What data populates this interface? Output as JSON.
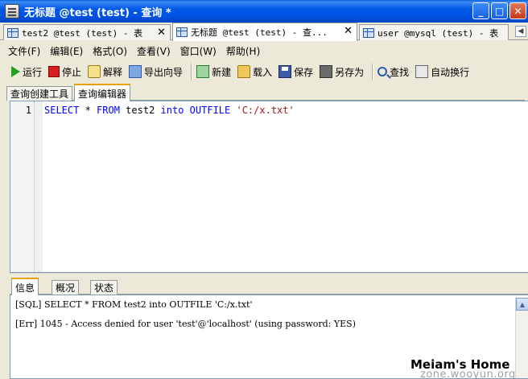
{
  "window": {
    "title": "无标题 @test (test) - 查询 *",
    "minimize_label": "_",
    "maximize_label": "□",
    "close_label": "✕"
  },
  "doc_tabs": [
    {
      "label": "test2 @test (test) - 表",
      "close": "✕"
    },
    {
      "label": "无标题 @test (test) - 查...",
      "close": "✕"
    },
    {
      "label": "user @mysql (test) - 表",
      "close": ""
    }
  ],
  "doc_tab_nav": {
    "prev": "◀",
    "next": "▶"
  },
  "menu": [
    "文件(F)",
    "编辑(E)",
    "格式(O)",
    "查看(V)",
    "窗口(W)",
    "帮助(H)"
  ],
  "toolbar": {
    "run": "运行",
    "stop": "停止",
    "explain": "解释",
    "export_wizard": "导出向导",
    "new": "新建",
    "load": "载入",
    "save": "保存",
    "save_as": "另存为",
    "find": "查找",
    "word_wrap": "自动换行"
  },
  "sub_tabs": [
    "查询创建工具",
    "查询编辑器"
  ],
  "editor": {
    "line_number": "1",
    "tokens": [
      "SELECT",
      " * ",
      "FROM",
      " test2 ",
      "into",
      " ",
      "OUTFILE",
      " 'C:/x.txt'"
    ]
  },
  "bottom_tabs": [
    "信息",
    "概况",
    "状态"
  ],
  "messages": {
    "sql_line": "[SQL] SELECT * FROM test2 into OUTFILE 'C:/x.txt'",
    "err_line": "[Err] 1045 - Access denied for user 'test'@'localhost' (using password: YES)"
  },
  "scrollbar": {
    "up": "▲"
  },
  "watermark": {
    "line1": "Meiam's Home",
    "line2": "zone.wooyun.org"
  },
  "icons": [
    "app-icon",
    "run-icon",
    "stop-icon",
    "explain-icon",
    "export-icon",
    "new-icon",
    "load-icon",
    "save-icon",
    "save-as-icon",
    "find-icon",
    "word-wrap-icon",
    "table-icon",
    "query-icon"
  ]
}
